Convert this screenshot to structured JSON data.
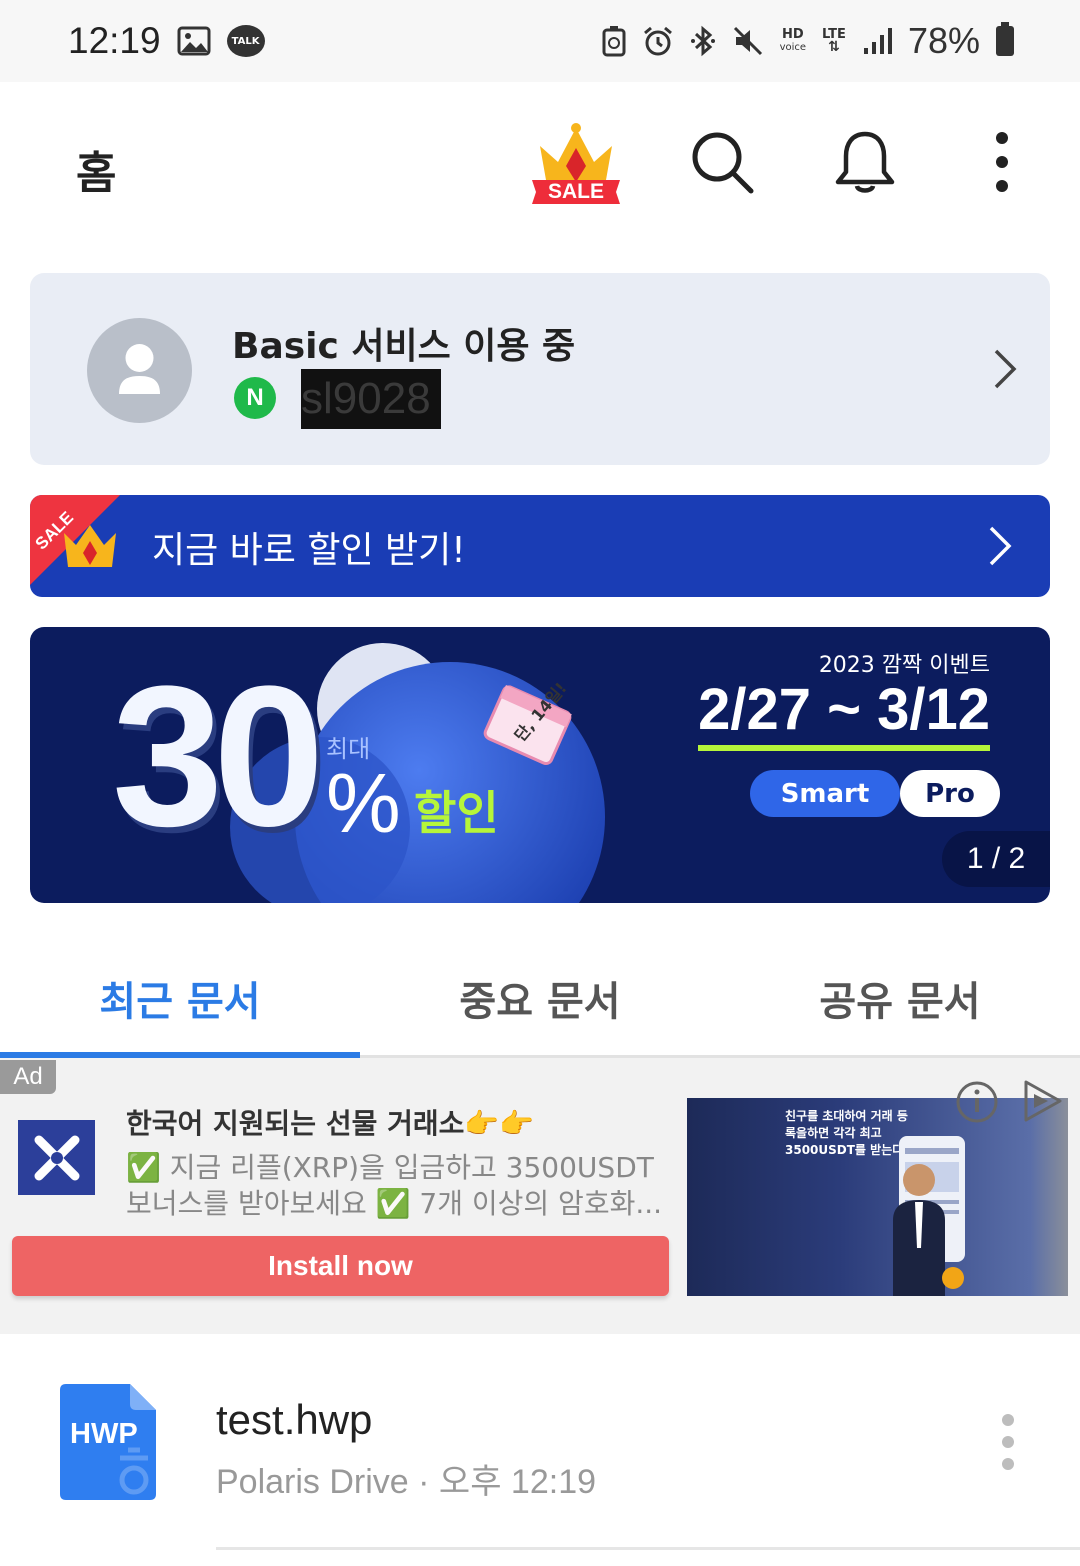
{
  "status_bar": {
    "time": "12:19",
    "talk_label": "TALK",
    "hd_label": "HD",
    "voice_label": "voice",
    "lte_label": "LTE",
    "battery_percent": "78%"
  },
  "header": {
    "title": "홈",
    "sale_badge_label": "SALE"
  },
  "account": {
    "plan_status": "Basic 서비스 이용 중",
    "provider_badge": "N",
    "user_id": "sl9028"
  },
  "discount_bar": {
    "corner_label": "SALE",
    "text": "지금 바로 할인 받기!"
  },
  "promo": {
    "big_number": "30",
    "max_label": "최대",
    "percent_sign": "%",
    "sale_label": "할인",
    "event_label": "2023 깜짝 이벤트",
    "dates": "2/27 ~ 3/12",
    "plan_pills": [
      "Smart",
      "Pro"
    ],
    "calendar_note": "단, 14일!",
    "page_indicator": "1 / 2"
  },
  "tabs": [
    {
      "label": "최근 문서",
      "active": true
    },
    {
      "label": "중요 문서",
      "active": false
    },
    {
      "label": "공유 문서",
      "active": false
    }
  ],
  "ad": {
    "tag": "Ad",
    "title": "한국어 지원되는 선물 거래소👉👉",
    "description": "✅ 지금 리플(XRP)을 입금하고 3500USDT 보너스를 받아보세요 ✅ 7개 이상의 암호화...",
    "install_label": "Install now",
    "image_text": "친구를 초대하여 거래 등록을하면 각각 최고 3500USDT를 받는다."
  },
  "files": [
    {
      "icon_label": "HWP",
      "name": "test.hwp",
      "meta": "Polaris Drive · 오후 12:19"
    }
  ],
  "colors": {
    "accent": "#2b7be5",
    "discount_bar": "#1a3db5",
    "promo_bg": "#0c1c5e",
    "install_button": "#ee6464",
    "hwp_icon": "#2f7ef0",
    "naver_green": "#1fb94a"
  },
  "icons": {
    "header": [
      "crown-sale-icon",
      "search-icon",
      "bell-icon",
      "more-vertical-icon"
    ],
    "status": [
      "gallery-icon",
      "talk-icon",
      "battery-saver-icon",
      "alarm-icon",
      "bluetooth-icon",
      "mute-icon",
      "signal-icon",
      "battery-icon"
    ]
  }
}
